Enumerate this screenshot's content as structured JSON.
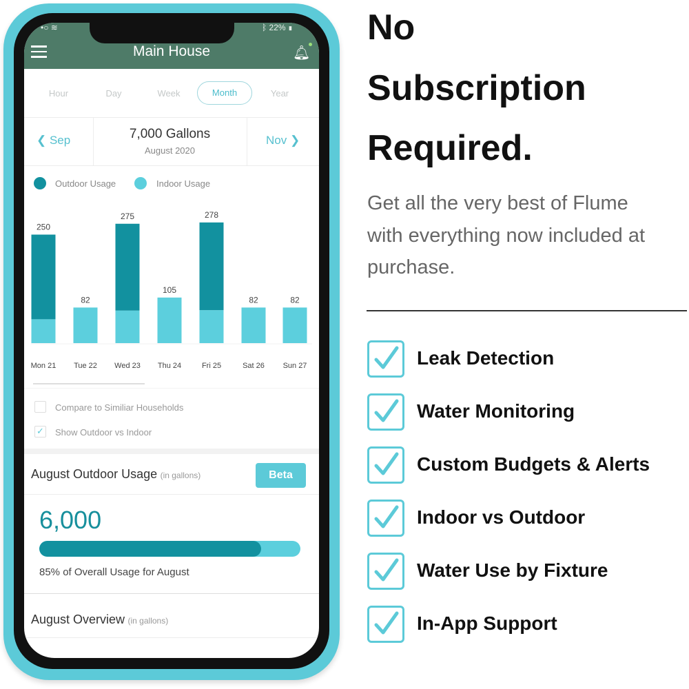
{
  "colors": {
    "case": "#5ccad8",
    "header": "#4e7b68",
    "outdoor": "#12919f",
    "indoor": "#5ccfdd",
    "accent": "#56c0cf"
  },
  "status_bar": {
    "battery": "22%",
    "icons": [
      "signal-icon",
      "wifi-icon",
      "bluetooth-icon",
      "battery-icon"
    ]
  },
  "header": {
    "title": "Main House",
    "menu_icon": "hamburger-icon",
    "bell_icon": "bell-icon"
  },
  "tabs": [
    {
      "label": "Hour"
    },
    {
      "label": "Day"
    },
    {
      "label": "Week"
    },
    {
      "label": "Month",
      "active": true
    },
    {
      "label": "Year"
    }
  ],
  "period": {
    "prev": "Sep",
    "next": "Nov",
    "total": "7,000 Gallons",
    "subtitle": "August 2020"
  },
  "chart_data": {
    "type": "bar",
    "stacked": true,
    "categories": [
      "Mon 21",
      "Tue 22",
      "Wed 23",
      "Thu 24",
      "Fri 25",
      "Sat 26",
      "Sun 27"
    ],
    "totals": [
      250,
      82,
      275,
      105,
      278,
      82,
      82
    ],
    "series": [
      {
        "name": "Outdoor Usage",
        "values": [
          195,
          0,
          200,
          0,
          202,
          0,
          0
        ]
      },
      {
        "name": "Indoor Usage",
        "values": [
          55,
          82,
          75,
          105,
          76,
          82,
          82
        ]
      }
    ],
    "data_labels": [
      "250",
      "82",
      "275",
      "105",
      "278",
      "82",
      "82"
    ],
    "legend": "top-left",
    "grid": false
  },
  "options": [
    {
      "label": "Compare to Similiar Households",
      "checked": false
    },
    {
      "label": "Show Outdoor vs Indoor",
      "checked": true
    }
  ],
  "outdoor": {
    "title": "August Outdoor Usage",
    "unit": "(in gallons)",
    "badge": "Beta",
    "value": "6,000",
    "progress": 0.85,
    "caption": "85% of Overall Usage for August"
  },
  "overview": {
    "title": "August Overview",
    "unit": "(in gallons)"
  },
  "promo": {
    "headline": [
      "No",
      "Subscription",
      "Required."
    ],
    "body": [
      "Get all the very best of Flume",
      "with everything now included at",
      "purchase."
    ],
    "features": [
      "Leak Detection",
      "Water Monitoring",
      "Custom Budgets & Alerts",
      "Indoor vs Outdoor",
      "Water Use by Fixture",
      "In-App Support"
    ]
  }
}
